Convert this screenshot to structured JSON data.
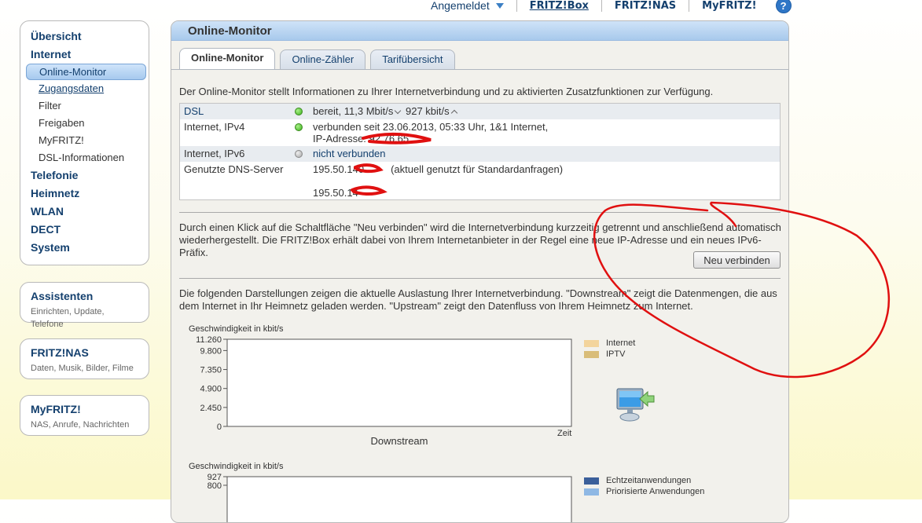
{
  "topnav": {
    "login_status": "Angemeldet",
    "fritzbox": "FRITZ!Box",
    "fritznas": "FRITZ!NAS",
    "myfritz": "MyFRITZ!",
    "help": "?"
  },
  "sidebar": {
    "overview": "Übersicht",
    "internet": "Internet",
    "internet_items": [
      "Online-Monitor",
      "Zugangsdaten",
      "Filter",
      "Freigaben",
      "MyFRITZ!",
      "DSL-Informationen"
    ],
    "telefonie": "Telefonie",
    "heimnetz": "Heimnetz",
    "wlan": "WLAN",
    "dect": "DECT",
    "system": "System"
  },
  "boxes": {
    "assistenten": {
      "title": "Assistenten",
      "sub": "Einrichten, Update, Telefone"
    },
    "fritznas": {
      "title": "FRITZ!NAS",
      "sub": "Daten, Musik, Bilder, Filme"
    },
    "myfritz": {
      "title": "MyFRITZ!",
      "sub": "NAS, Anrufe, Nachrichten"
    }
  },
  "panel": {
    "title": "Online-Monitor",
    "tabs": [
      "Online-Monitor",
      "Online-Zähler",
      "Tarifübersicht"
    ],
    "intro": "Der Online-Monitor stellt Informationen zu Ihrer Internetverbindung und zu aktivierten Zusatzfunktionen zur Verfügung."
  },
  "status": {
    "dsl_label": "DSL",
    "dsl_down": "bereit, 11,3 Mbit/s",
    "dsl_up": "927 kbit/s",
    "ipv4_label": "Internet, IPv4",
    "ipv4_line1": "verbunden seit 23.06.2013, 05:33 Uhr, 1&1 Internet,",
    "ipv4_line2": "IP-Adresse: 92.76.65",
    "ipv6_label": "Internet, IPv6",
    "ipv6_value": "nicht verbunden",
    "dns_label": "Genutzte DNS-Server",
    "dns1": "195.50.140",
    "dns1_note": "(aktuell genutzt für Standardanfragen)",
    "dns2": "195.50.14"
  },
  "reconnect": {
    "text": "Durch einen Klick auf die Schaltfläche \"Neu verbinden\" wird die Internetverbindung kurzzeitig getrennt und anschließend automatisch wiederhergestellt. Die FRITZ!Box erhält dabei von Ihrem Internetanbieter in der Regel eine neue IP-Adresse und ein neues IPv6-Präfix.",
    "button": "Neu verbinden"
  },
  "usage": {
    "text": "Die folgenden Darstellungen zeigen die aktuelle Auslastung Ihrer Internetverbindung. \"Downstream\" zeigt die Datenmengen, die aus dem Internet in Ihr Heimnetz geladen werden. \"Upstream\" zeigt den Datenfluss von Ihrem Heimnetz zum Internet."
  },
  "chart_data": [
    {
      "type": "area",
      "ylabel": "Geschwindigkeit in kbit/s",
      "xlabel": "Zeit",
      "caption": "Downstream",
      "yticks": [
        "11.260",
        "9.800",
        "7.350",
        "4.900",
        "2.450",
        "0"
      ],
      "ylim": [
        0,
        11260
      ],
      "series": [
        {
          "name": "Internet",
          "color": "#f3d49c",
          "values": []
        },
        {
          "name": "IPTV",
          "color": "#d9bd79",
          "values": []
        }
      ]
    },
    {
      "type": "area",
      "ylabel": "Geschwindigkeit in kbit/s",
      "yticks": [
        "927",
        "800"
      ],
      "ylim": [
        0,
        927
      ],
      "series": [
        {
          "name": "Echtzeitanwendungen",
          "color": "#3b5f9a",
          "values": []
        },
        {
          "name": "Priorisierte Anwendungen",
          "color": "#8fb8e4",
          "values": []
        }
      ]
    }
  ]
}
